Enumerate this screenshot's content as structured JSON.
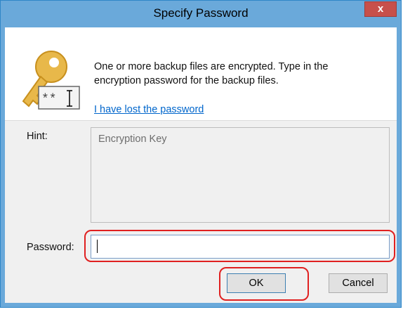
{
  "dialog": {
    "title": "Specify Password",
    "close_label": "x"
  },
  "message": {
    "text": "One or more backup files are encrypted. Type in the encryption password for the backup files.",
    "lost_password_link": "I have lost the password"
  },
  "icon": {
    "name": "key-icon",
    "badge_text": "**"
  },
  "hint": {
    "label": "Hint:",
    "value": "Encryption Key"
  },
  "password": {
    "label": "Password:",
    "value": ""
  },
  "buttons": {
    "ok": "OK",
    "cancel": "Cancel"
  },
  "colors": {
    "titlebar": "#6aa9da",
    "close_button": "#c7504b",
    "highlight": "#e02020",
    "link": "#0066cc"
  }
}
